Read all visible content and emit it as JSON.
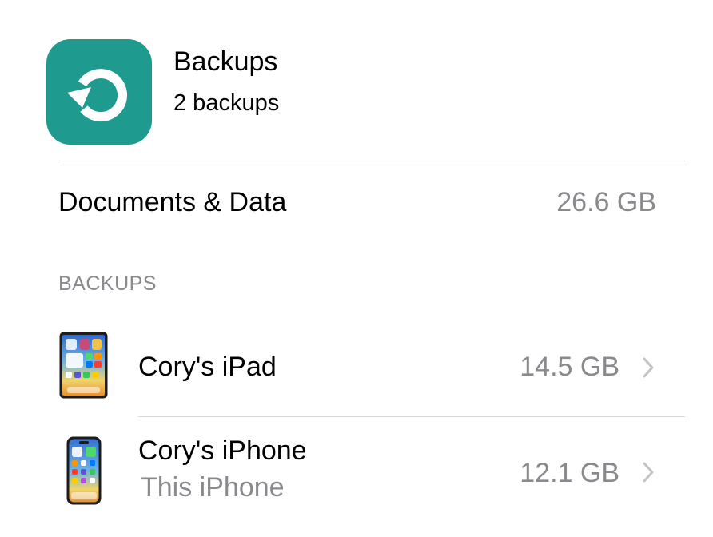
{
  "header": {
    "icon": "backup-restore-icon",
    "title": "Backups",
    "subtitle": "2 backups",
    "accent_color": "#1f9a8e"
  },
  "documents": {
    "label": "Documents & Data",
    "value": "26.6 GB"
  },
  "backups_section": {
    "header": "BACKUPS",
    "items": [
      {
        "name": "Cory's iPad",
        "subtitle": "",
        "size": "14.5 GB",
        "icon": "ipad-icon"
      },
      {
        "name": "Cory's iPhone",
        "subtitle": "This iPhone",
        "size": "12.1 GB",
        "icon": "iphone-icon"
      }
    ]
  },
  "colors": {
    "secondary_text": "#8a8a8e",
    "separator": "#d6d6d8",
    "chevron": "#c4c4c7"
  }
}
